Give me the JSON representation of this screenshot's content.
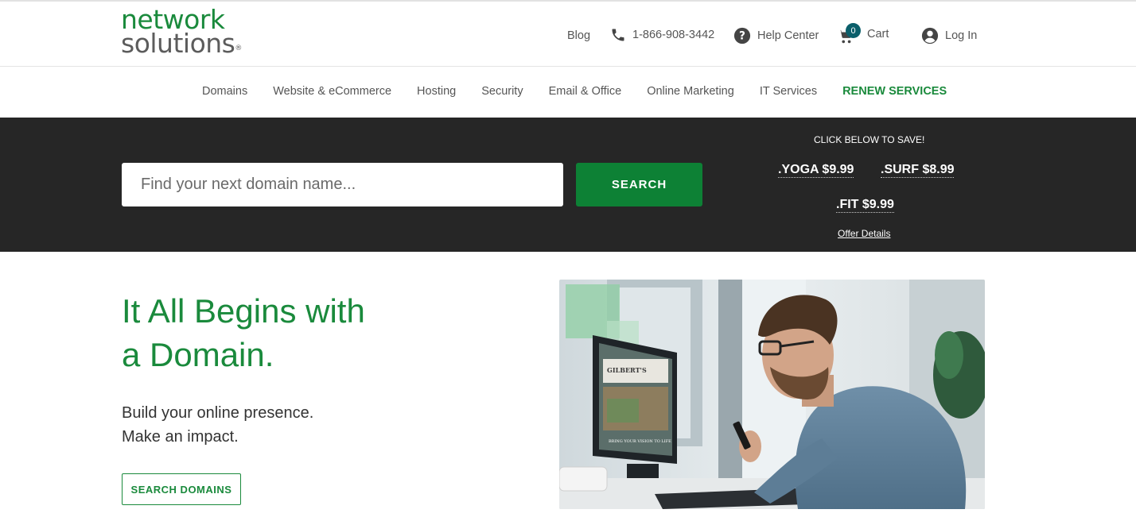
{
  "header": {
    "logo": {
      "line1": "network",
      "line2": "solutions",
      "reg": "®"
    },
    "blog_label": "Blog",
    "phone": "1-866-908-3442",
    "help_label": "Help Center",
    "cart_count": "0",
    "cart_label": "Cart",
    "login_label": "Log In"
  },
  "nav": {
    "items": [
      {
        "label": "Domains"
      },
      {
        "label": "Website & eCommerce"
      },
      {
        "label": "Hosting"
      },
      {
        "label": "Security"
      },
      {
        "label": "Email & Office"
      },
      {
        "label": "Online Marketing"
      },
      {
        "label": "IT Services"
      },
      {
        "label": "RENEW SERVICES"
      }
    ]
  },
  "search": {
    "placeholder": "Find your next domain name...",
    "button_label": "SEARCH"
  },
  "promo": {
    "title": "CLICK BELOW TO SAVE!",
    "offers": [
      {
        "label": ".YOGA $9.99"
      },
      {
        "label": ".SURF $8.99"
      },
      {
        "label": ".FIT $9.99"
      }
    ],
    "details_link": "Offer Details"
  },
  "hero": {
    "title_line1": "It All Begins with",
    "title_line2": "a Domain.",
    "sub_line1": "Build your online presence.",
    "sub_line2": "Make an impact.",
    "button_label": "SEARCH DOMAINS",
    "screen_caption": "GILBERT'S",
    "screen_tagline": "BRING YOUR VISION TO LIFE"
  },
  "colors": {
    "brand_green": "#1a8a3c",
    "button_green": "#0d8135",
    "band_dark": "#262626",
    "badge_teal": "#0b5f6b"
  },
  "icons": [
    "phone-icon",
    "help-icon",
    "cart-icon",
    "user-icon"
  ]
}
